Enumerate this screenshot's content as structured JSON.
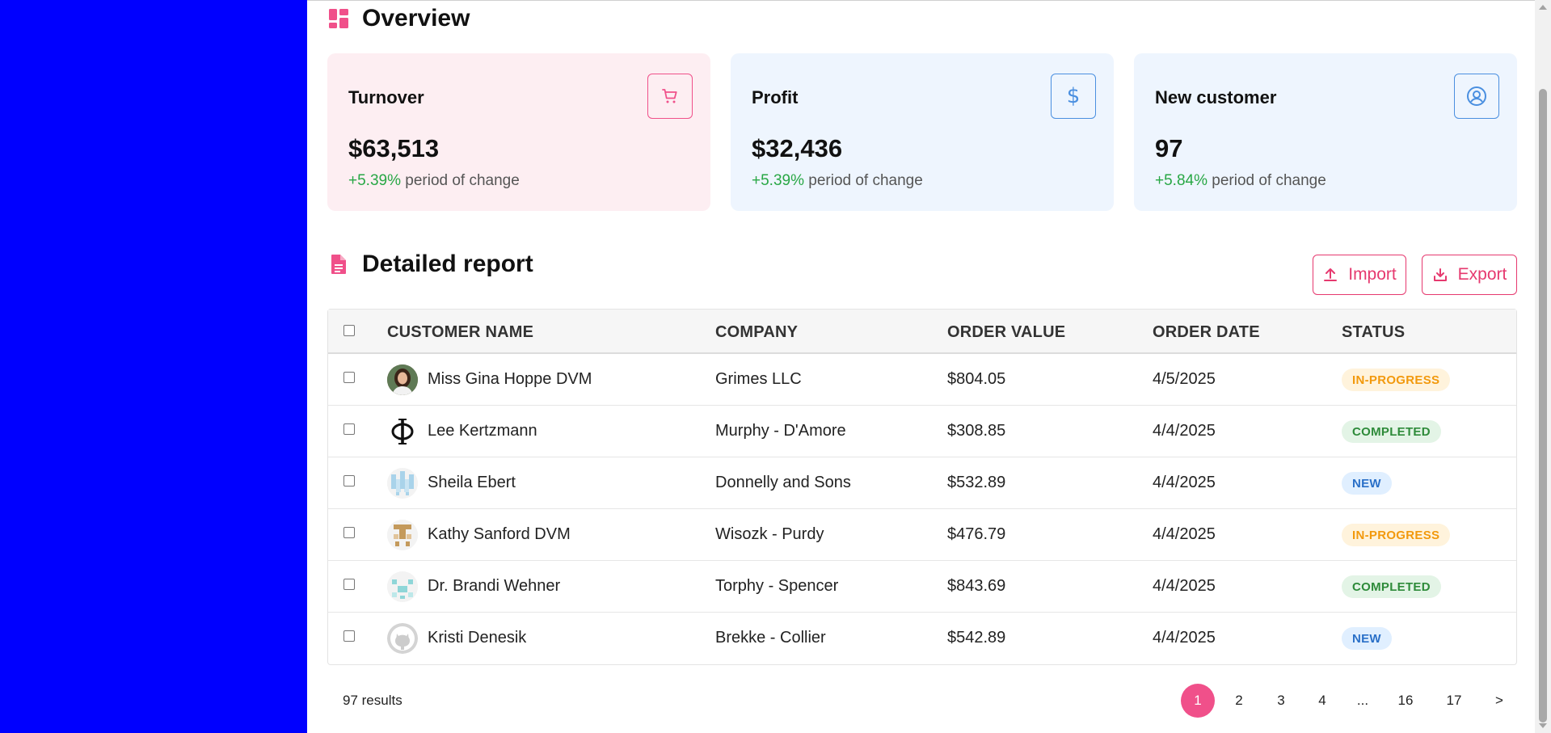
{
  "overview": {
    "title": "Overview",
    "title_icon": "dashboard-icon",
    "cards": [
      {
        "title": "Turnover",
        "value": "$63,513",
        "change": "+5.39%",
        "change_text": "period of change",
        "icon": "cart-icon"
      },
      {
        "title": "Profit",
        "value": "$32,436",
        "change": "+5.39%",
        "change_text": "period of change",
        "icon": "dollar-icon"
      },
      {
        "title": "New customer",
        "value": "97",
        "change": "+5.84%",
        "change_text": "period of change",
        "icon": "user-circle-icon"
      }
    ]
  },
  "report": {
    "title": "Detailed report",
    "title_icon": "document-icon",
    "import_label": "Import",
    "export_label": "Export",
    "columns": [
      "CUSTOMER NAME",
      "COMPANY",
      "ORDER VALUE",
      "ORDER DATE",
      "STATUS"
    ],
    "rows": [
      {
        "name": "Miss Gina Hoppe DVM",
        "company": "Grimes LLC",
        "value": "$804.05",
        "date": "4/5/2025",
        "status": "IN-PROGRESS"
      },
      {
        "name": "Lee Kertzmann",
        "company": "Murphy - D'Amore",
        "value": "$308.85",
        "date": "4/4/2025",
        "status": "COMPLETED"
      },
      {
        "name": "Sheila Ebert",
        "company": "Donnelly and Sons",
        "value": "$532.89",
        "date": "4/4/2025",
        "status": "NEW"
      },
      {
        "name": "Kathy Sanford DVM",
        "company": "Wisozk - Purdy",
        "value": "$476.79",
        "date": "4/4/2025",
        "status": "IN-PROGRESS"
      },
      {
        "name": "Dr. Brandi Wehner",
        "company": "Torphy - Spencer",
        "value": "$843.69",
        "date": "4/4/2025",
        "status": "COMPLETED"
      },
      {
        "name": "Kristi Denesik",
        "company": "Brekke - Collier",
        "value": "$542.89",
        "date": "4/4/2025",
        "status": "NEW"
      }
    ]
  },
  "pagination": {
    "results": "97 results",
    "pages": [
      "1",
      "2",
      "3",
      "4",
      "...",
      "16",
      "17",
      ">"
    ],
    "current": "1"
  },
  "colors": {
    "sidebar": "#0000ff",
    "accent": "#f0508a",
    "positive": "#28a745"
  }
}
